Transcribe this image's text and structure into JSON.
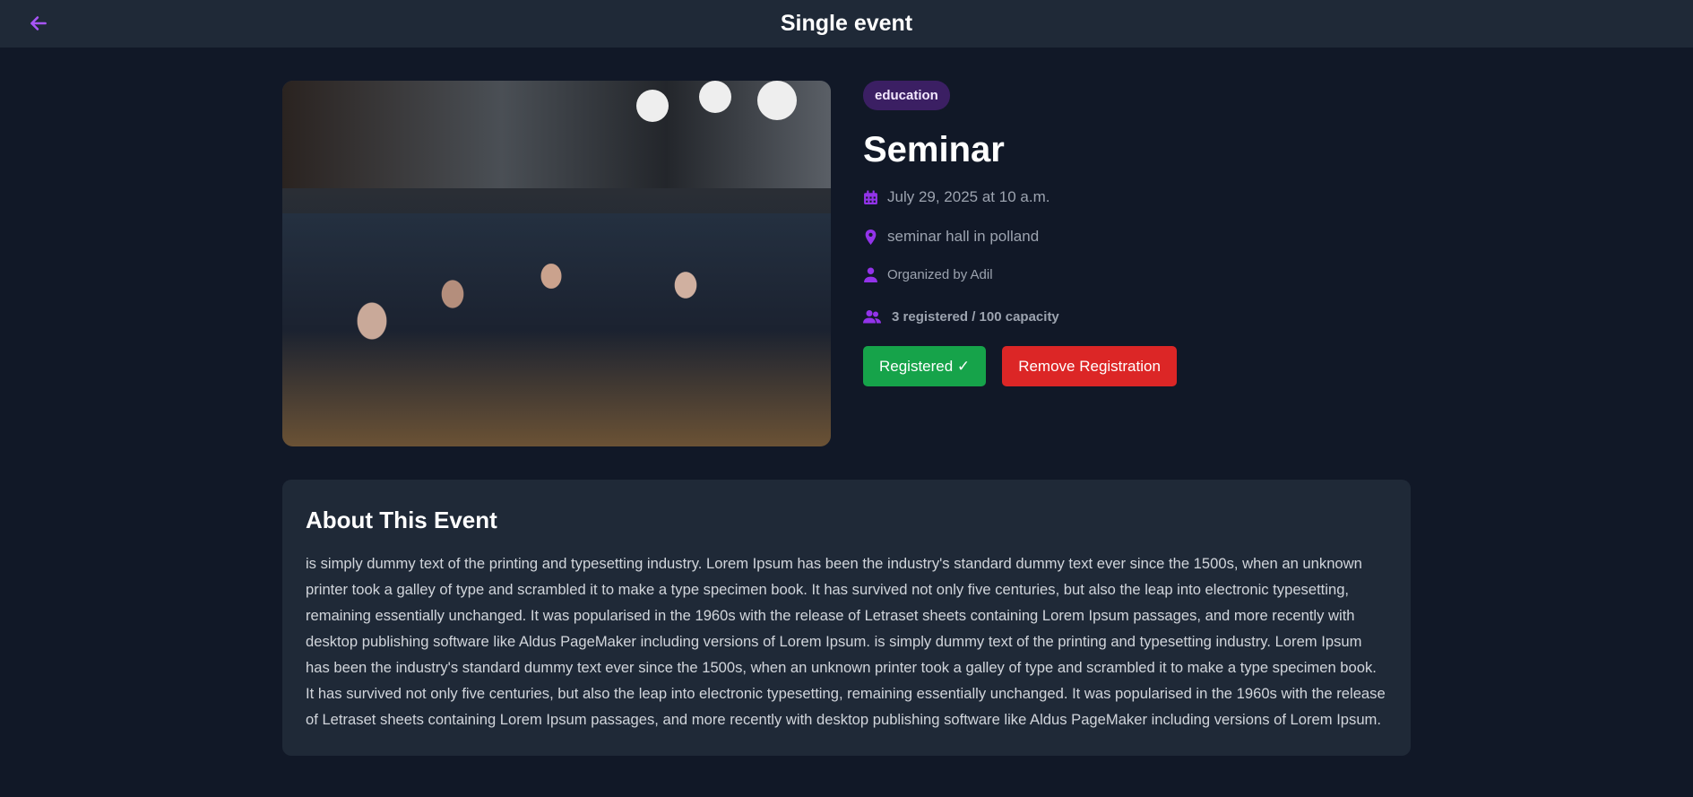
{
  "header": {
    "title": "Single event",
    "back_icon": "arrow-left-icon"
  },
  "colors": {
    "accent": "#9333ea",
    "registered": "#16a34a",
    "remove": "#dc2626",
    "badge": "#3b1f63"
  },
  "event": {
    "category": "education",
    "title": "Seminar",
    "date": "July 29, 2025 at 10 a.m.",
    "location": "seminar hall in polland",
    "organizer": "Organized by Adil",
    "capacity": "3 registered / 100 capacity",
    "registered_label": "Registered ✓",
    "remove_label": "Remove Registration"
  },
  "about": {
    "heading": "About This Event",
    "body": "is simply dummy text of the printing and typesetting industry. Lorem Ipsum has been the industry's standard dummy text ever since the 1500s, when an unknown printer took a galley of type and scrambled it to make a type specimen book. It has survived not only five centuries, but also the leap into electronic typesetting, remaining essentially unchanged. It was popularised in the 1960s with the release of Letraset sheets containing Lorem Ipsum passages, and more recently with desktop publishing software like Aldus PageMaker including versions of Lorem Ipsum. is simply dummy text of the printing and typesetting industry. Lorem Ipsum has been the industry's standard dummy text ever since the 1500s, when an unknown printer took a galley of type and scrambled it to make a type specimen book. It has survived not only five centuries, but also the leap into electronic typesetting, remaining essentially unchanged. It was popularised in the 1960s with the release of Letraset sheets containing Lorem Ipsum passages, and more recently with desktop publishing software like Aldus PageMaker including versions of Lorem Ipsum."
  }
}
